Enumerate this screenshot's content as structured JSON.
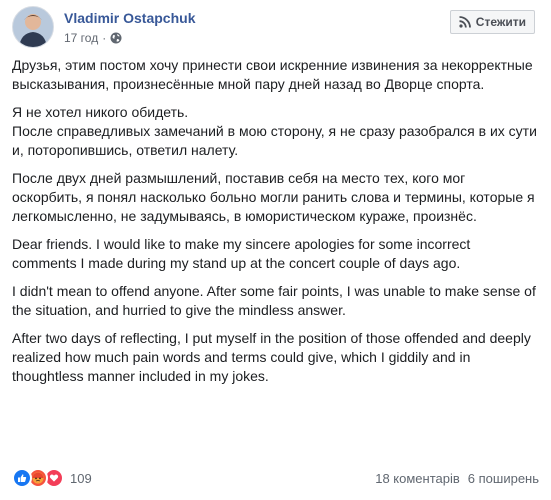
{
  "post": {
    "author": "Vladimir Ostapchuk",
    "time": "17 год",
    "separator": "·",
    "privacy_icon": "globe-icon",
    "follow_label": "Стежити",
    "follow_icon": "rss-icon",
    "paragraphs": [
      "Друзья, этим постом хочу принести свои искренние извинения за некорректные высказывания, произнесённые мной пару дней назад во Дворце спорта.",
      "Я не хотел никого обидеть.\nПосле справедливых замечаний в мою сторону, я не сразу разобрался в их сути и, поторопившись, ответил налету.",
      "После двух дней размышлений, поставив себя на место тех, кого мог оскорбить, я понял насколько больно могли ранить слова и термины, которые я легкомысленно, не задумываясь, в юмористическом кураже, произнёс.",
      "Dear friends. I would like to make my sincere apologies for some incorrect comments I made during my stand up at the concert couple of days ago.",
      "I didn't mean to offend anyone. After some fair points, I was unable to make sense of the situation, and hurried to give the mindless answer.",
      "After two days of reflecting, I put myself in the position of those offended and deeply realized how much pain words and terms could give, which I giddily and in thoughtless manner included in my jokes."
    ]
  },
  "footer": {
    "reactions": [
      "like-icon",
      "angry-icon",
      "love-icon"
    ],
    "reaction_count": "109",
    "comments": "18 коментарів",
    "shares": "6 поширень"
  },
  "colors": {
    "author_link": "#385898",
    "like": "#1877f2",
    "angry": "#f5533d",
    "love": "#f33e58"
  }
}
